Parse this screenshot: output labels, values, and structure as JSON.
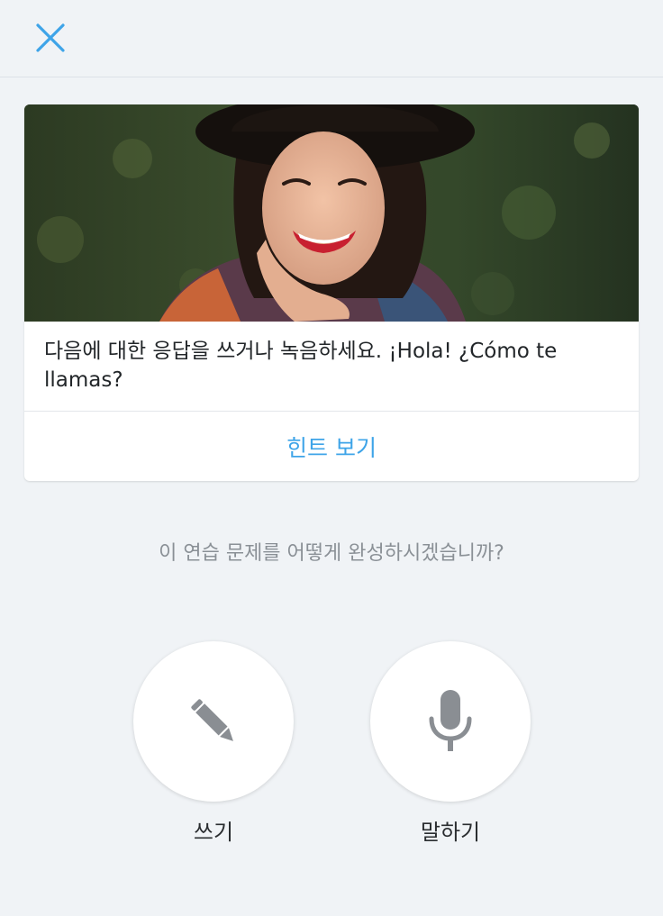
{
  "header": {
    "close_icon": "close-icon",
    "accent_color": "#3ea4e8"
  },
  "exercise": {
    "image_alt_icon": "portrait-photo",
    "prompt": "다음에 대한 응답을 쓰거나 녹음하세요. ¡Hola! ¿Cómo te llamas?",
    "hint_label": "힌트 보기"
  },
  "question": "이 연습 문제를 어떻게 완성하시겠습니까?",
  "options": [
    {
      "label": "쓰기",
      "icon": "pencil-icon"
    },
    {
      "label": "말하기",
      "icon": "microphone-icon"
    }
  ]
}
